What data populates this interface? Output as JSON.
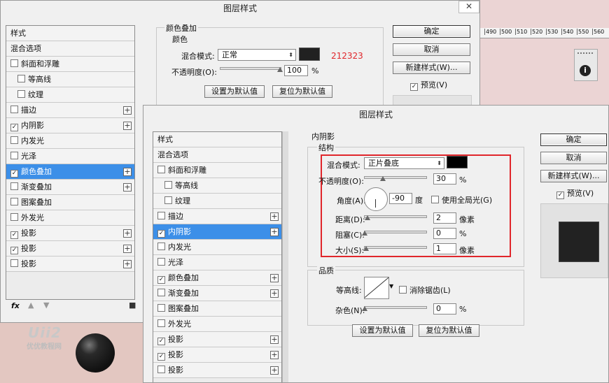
{
  "bg_dialog": {
    "title": "图层样式",
    "close": "✕",
    "styles": [
      {
        "label": "样式",
        "check": "none"
      },
      {
        "label": "混合选项",
        "check": "none"
      },
      {
        "label": "斜面和浮雕",
        "check": "off",
        "plus": false
      },
      {
        "label": "等高线",
        "check": "off",
        "indent": true
      },
      {
        "label": "纹理",
        "check": "off",
        "indent": true
      },
      {
        "label": "描边",
        "check": "off",
        "plus": true
      },
      {
        "label": "内阴影",
        "check": "on",
        "plus": true
      },
      {
        "label": "内发光",
        "check": "off"
      },
      {
        "label": "光泽",
        "check": "off"
      },
      {
        "label": "颜色叠加",
        "check": "on",
        "plus": true,
        "selected": true
      },
      {
        "label": "渐变叠加",
        "check": "off",
        "plus": true
      },
      {
        "label": "图案叠加",
        "check": "off"
      },
      {
        "label": "外发光",
        "check": "off"
      },
      {
        "label": "投影",
        "check": "on",
        "plus": true
      },
      {
        "label": "投影",
        "check": "on",
        "plus": true
      },
      {
        "label": "投影",
        "check": "off",
        "plus": true
      }
    ],
    "section_title": "颜色叠加",
    "sub_title": "颜色",
    "blend_label": "混合模式:",
    "blend_value": "正常",
    "color_hex": "212323",
    "opacity_label": "不透明度(O):",
    "opacity_value": "100",
    "percent": "%",
    "set_default": "设置为默认值",
    "reset_default": "复位为默认值",
    "ok": "确定",
    "cancel": "取消",
    "new_style": "新建样式(W)...",
    "preview": "预览(V)",
    "fx": "fx"
  },
  "ruler": {
    "ticks": [
      "490",
      "500",
      "510",
      "520",
      "530",
      "540",
      "550",
      "560"
    ]
  },
  "watermark": {
    "line1": "Uii2",
    "line2": "优优教程网"
  },
  "fg_dialog": {
    "title": "图层样式",
    "styles": [
      {
        "label": "样式",
        "check": "none"
      },
      {
        "label": "混合选项",
        "check": "none"
      },
      {
        "label": "斜面和浮雕",
        "check": "off"
      },
      {
        "label": "等高线",
        "check": "off",
        "indent": true
      },
      {
        "label": "纹理",
        "check": "off",
        "indent": true
      },
      {
        "label": "描边",
        "check": "off",
        "plus": true
      },
      {
        "label": "内阴影",
        "check": "on",
        "plus": true,
        "selected": true
      },
      {
        "label": "内发光",
        "check": "off"
      },
      {
        "label": "光泽",
        "check": "off"
      },
      {
        "label": "颜色叠加",
        "check": "on",
        "plus": true
      },
      {
        "label": "渐变叠加",
        "check": "off",
        "plus": true
      },
      {
        "label": "图案叠加",
        "check": "off"
      },
      {
        "label": "外发光",
        "check": "off"
      },
      {
        "label": "投影",
        "check": "on",
        "plus": true
      },
      {
        "label": "投影",
        "check": "on",
        "plus": true
      },
      {
        "label": "投影",
        "check": "off",
        "plus": true
      }
    ],
    "section_title": "内阴影",
    "structure_title": "结构",
    "blend_label": "混合模式:",
    "blend_value": "正片叠底",
    "opacity_label": "不透明度(O):",
    "opacity_value": "30",
    "angle_label": "角度(A):",
    "angle_value": "-90",
    "angle_unit": "度",
    "global_light": "使用全局光(G)",
    "distance_label": "距离(D):",
    "distance_value": "2",
    "choke_label": "阻塞(C):",
    "choke_value": "0",
    "size_label": "大小(S):",
    "size_value": "1",
    "px": "像素",
    "percent": "%",
    "quality_title": "品质",
    "contour_label": "等高线:",
    "antialias": "消除锯齿(L)",
    "noise_label": "杂色(N):",
    "noise_value": "0",
    "set_default": "设置为默认值",
    "reset_default": "复位为默认值",
    "ok": "确定",
    "cancel": "取消",
    "new_style": "新建样式(W)...",
    "preview": "预览(V)",
    "highlight_color": "#e0262b"
  }
}
